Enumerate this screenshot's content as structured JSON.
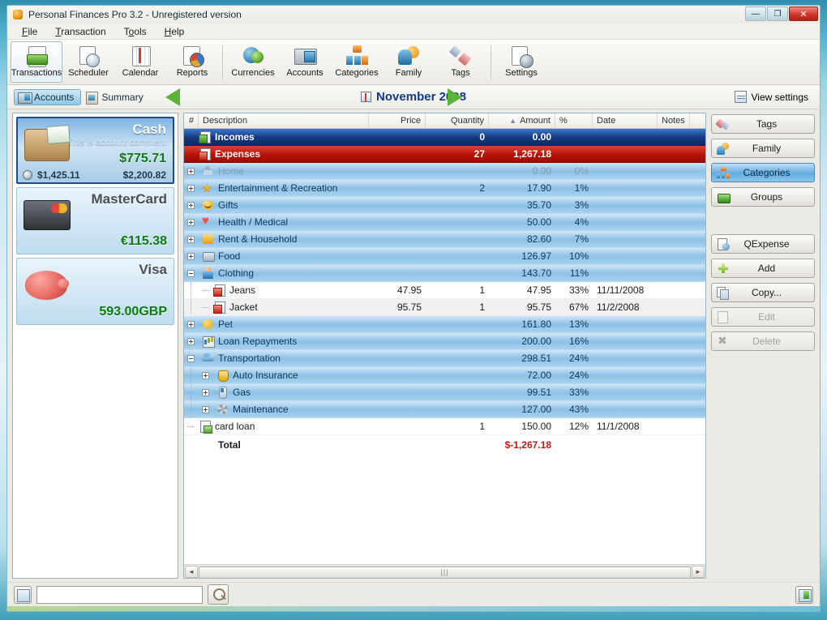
{
  "window": {
    "title": "Personal Finances Pro 3.2 - Unregistered version",
    "app_icon": "app-icon",
    "minimize": "—",
    "maximize": "❐",
    "close": "✕"
  },
  "menubar": [
    {
      "label": "File",
      "accel": "F"
    },
    {
      "label": "Transaction",
      "accel": "T"
    },
    {
      "label": "Tools",
      "accel": "o"
    },
    {
      "label": "Help",
      "accel": "H"
    }
  ],
  "toolbar": {
    "items": [
      {
        "label": "Transactions",
        "icon": "transactions-icon",
        "active": true
      },
      {
        "label": "Scheduler",
        "icon": "scheduler-icon",
        "active": false
      },
      {
        "label": "Calendar",
        "icon": "calendar-icon",
        "active": false
      },
      {
        "label": "Reports",
        "icon": "reports-icon",
        "active": false
      },
      {
        "label": "Currencies",
        "icon": "currencies-icon",
        "active": false
      },
      {
        "label": "Accounts",
        "icon": "accounts-icon",
        "active": false
      },
      {
        "label": "Categories",
        "icon": "categories-icon",
        "active": false
      },
      {
        "label": "Family",
        "icon": "family-icon",
        "active": false
      },
      {
        "label": "Tags",
        "icon": "tags-icon",
        "active": false
      },
      {
        "label": "Settings",
        "icon": "settings-icon",
        "active": false
      }
    ]
  },
  "navbar": {
    "accounts_tab": "Accounts",
    "summary_tab": "Summary",
    "prev_icon": "previous-period-arrow",
    "next_icon": "next-period-arrow",
    "period": "November 2008",
    "view_settings": "View settings"
  },
  "sidebar": {
    "accounts": [
      {
        "name": "Cash",
        "comment": "This is account comment",
        "balance": "$775.71",
        "secondary_left": "$1,425.11",
        "secondary_right": "$2,200.82",
        "icon": "wallet-icon",
        "selected": true
      },
      {
        "name": "MasterCard",
        "comment": "",
        "balance": "€115.38",
        "secondary_left": "",
        "secondary_right": "",
        "icon": "credit-card-icon",
        "selected": false
      },
      {
        "name": "Visa",
        "comment": "",
        "balance": "593.00GBP",
        "secondary_left": "",
        "secondary_right": "",
        "icon": "piggy-bank-icon",
        "selected": false
      }
    ]
  },
  "grid": {
    "columns": [
      {
        "key": "num",
        "label": "#"
      },
      {
        "key": "description",
        "label": "Description"
      },
      {
        "key": "price",
        "label": "Price"
      },
      {
        "key": "quantity",
        "label": "Quantity"
      },
      {
        "key": "amount",
        "label": "Amount",
        "sorted": true,
        "sort_mark": "▲"
      },
      {
        "key": "percent",
        "label": "%"
      },
      {
        "key": "date",
        "label": "Date"
      },
      {
        "key": "notes",
        "label": "Notes"
      }
    ],
    "rows": [
      {
        "type": "header-income",
        "icon": "income-doc-icon",
        "description": "Incomes",
        "price": "",
        "quantity": "0",
        "amount": "0.00",
        "percent": "",
        "date": "",
        "notes": ""
      },
      {
        "type": "header-expense",
        "icon": "expense-doc-icon",
        "description": "Expenses",
        "price": "",
        "quantity": "27",
        "amount": "1,267.18",
        "percent": "",
        "date": "",
        "notes": ""
      },
      {
        "type": "category",
        "toggle": "plus",
        "depth": 0,
        "muted": true,
        "icon": "home-icon",
        "description": "Home",
        "price": "",
        "quantity": "",
        "amount": "0.00",
        "percent": "0%",
        "date": "",
        "notes": ""
      },
      {
        "type": "category",
        "toggle": "plus",
        "depth": 0,
        "icon": "star-icon",
        "description": "Entertainment & Recreation",
        "price": "",
        "quantity": "2",
        "amount": "17.90",
        "percent": "1%",
        "date": "",
        "notes": ""
      },
      {
        "type": "category",
        "toggle": "plus",
        "depth": 0,
        "icon": "gift-icon",
        "description": "Gifts",
        "price": "",
        "quantity": "",
        "amount": "35.70",
        "percent": "3%",
        "date": "",
        "notes": ""
      },
      {
        "type": "category",
        "toggle": "plus",
        "depth": 0,
        "icon": "heart-icon",
        "description": "Health / Medical",
        "price": "",
        "quantity": "",
        "amount": "50.00",
        "percent": "4%",
        "date": "",
        "notes": ""
      },
      {
        "type": "category",
        "toggle": "plus",
        "depth": 0,
        "icon": "rent-icon",
        "description": "Rent & Household",
        "price": "",
        "quantity": "",
        "amount": "82.60",
        "percent": "7%",
        "date": "",
        "notes": ""
      },
      {
        "type": "category",
        "toggle": "plus",
        "depth": 0,
        "icon": "food-icon",
        "description": "Food",
        "price": "",
        "quantity": "",
        "amount": "126.97",
        "percent": "10%",
        "date": "",
        "notes": ""
      },
      {
        "type": "category",
        "toggle": "minus",
        "depth": 0,
        "icon": "clothing-icon",
        "description": "Clothing",
        "price": "",
        "quantity": "",
        "amount": "143.70",
        "percent": "11%",
        "date": "",
        "notes": ""
      },
      {
        "type": "leaf",
        "toggle": "dash",
        "depth": 1,
        "icon": "transaction-icon",
        "description": "Jeans",
        "price": "47.95",
        "quantity": "1",
        "amount": "47.95",
        "percent": "33%",
        "date": "11/11/2008",
        "notes": ""
      },
      {
        "type": "leaf",
        "toggle": "dash",
        "depth": 1,
        "alt": true,
        "icon": "transaction-icon",
        "description": "Jacket",
        "price": "95.75",
        "quantity": "1",
        "amount": "95.75",
        "percent": "67%",
        "date": "11/2/2008",
        "notes": ""
      },
      {
        "type": "category",
        "toggle": "plus",
        "depth": 0,
        "icon": "pet-icon",
        "description": "Pet",
        "price": "",
        "quantity": "",
        "amount": "161.80",
        "percent": "13%",
        "date": "",
        "notes": ""
      },
      {
        "type": "category",
        "toggle": "plus",
        "depth": 0,
        "icon": "loan-icon",
        "description": "Loan Repayments",
        "price": "",
        "quantity": "",
        "amount": "200.00",
        "percent": "16%",
        "date": "",
        "notes": ""
      },
      {
        "type": "category",
        "toggle": "minus",
        "depth": 0,
        "icon": "transportation-icon",
        "description": "Transportation",
        "price": "",
        "quantity": "",
        "amount": "298.51",
        "percent": "24%",
        "date": "",
        "notes": ""
      },
      {
        "type": "category",
        "toggle": "plus",
        "depth": 1,
        "icon": "insurance-icon",
        "description": "Auto Insurance",
        "price": "",
        "quantity": "",
        "amount": "72.00",
        "percent": "24%",
        "date": "",
        "notes": ""
      },
      {
        "type": "category",
        "toggle": "plus",
        "depth": 1,
        "icon": "gas-icon",
        "description": "Gas",
        "price": "",
        "quantity": "",
        "amount": "99.51",
        "percent": "33%",
        "date": "",
        "notes": ""
      },
      {
        "type": "category",
        "toggle": "plus",
        "depth": 1,
        "icon": "maintenance-icon",
        "description": "Maintenance",
        "price": "",
        "quantity": "",
        "amount": "127.00",
        "percent": "43%",
        "date": "",
        "notes": ""
      },
      {
        "type": "leaf",
        "toggle": "dash",
        "depth": 0,
        "icon": "card-loan-icon",
        "description": "card loan",
        "price": "",
        "quantity": "1",
        "amount": "150.00",
        "percent": "12%",
        "date": "11/1/2008",
        "notes": ""
      }
    ],
    "total": {
      "label": "Total",
      "amount": "$-1,267.18"
    },
    "scrollbar": {
      "left_arrow": "◄",
      "right_arrow": "►",
      "grip": "|||"
    }
  },
  "right_panel": {
    "buttons": [
      {
        "label": "Tags",
        "icon": "tags-icon",
        "state": "normal"
      },
      {
        "label": "Family",
        "icon": "family-icon",
        "state": "normal"
      },
      {
        "label": "Categories",
        "icon": "categories-icon",
        "state": "active"
      },
      {
        "label": "Groups",
        "icon": "groups-icon",
        "state": "normal"
      },
      {
        "label": "QExpense",
        "icon": "qexpense-icon",
        "state": "normal",
        "gap_before": true
      },
      {
        "label": "Add",
        "icon": "add-icon",
        "state": "normal"
      },
      {
        "label": "Copy...",
        "icon": "copy-icon",
        "state": "normal"
      },
      {
        "label": "Edit",
        "icon": "edit-icon",
        "state": "disabled"
      },
      {
        "label": "Delete",
        "icon": "delete-icon",
        "state": "disabled"
      }
    ]
  },
  "footer": {
    "left_button_icon": "panel-toggle-left-icon",
    "search_value": "",
    "search_placeholder": "",
    "search_button_icon": "search-icon",
    "right_button_icon": "panel-toggle-right-icon"
  },
  "colors": {
    "income_row": "#14377f",
    "expense_row": "#b81207",
    "category_row": "#8cc0e6",
    "total_amount": "#c01a0c",
    "balance_green": "#0e7a12",
    "period_blue": "#123a8c",
    "accent_green_arrow": "#5cb23a"
  }
}
